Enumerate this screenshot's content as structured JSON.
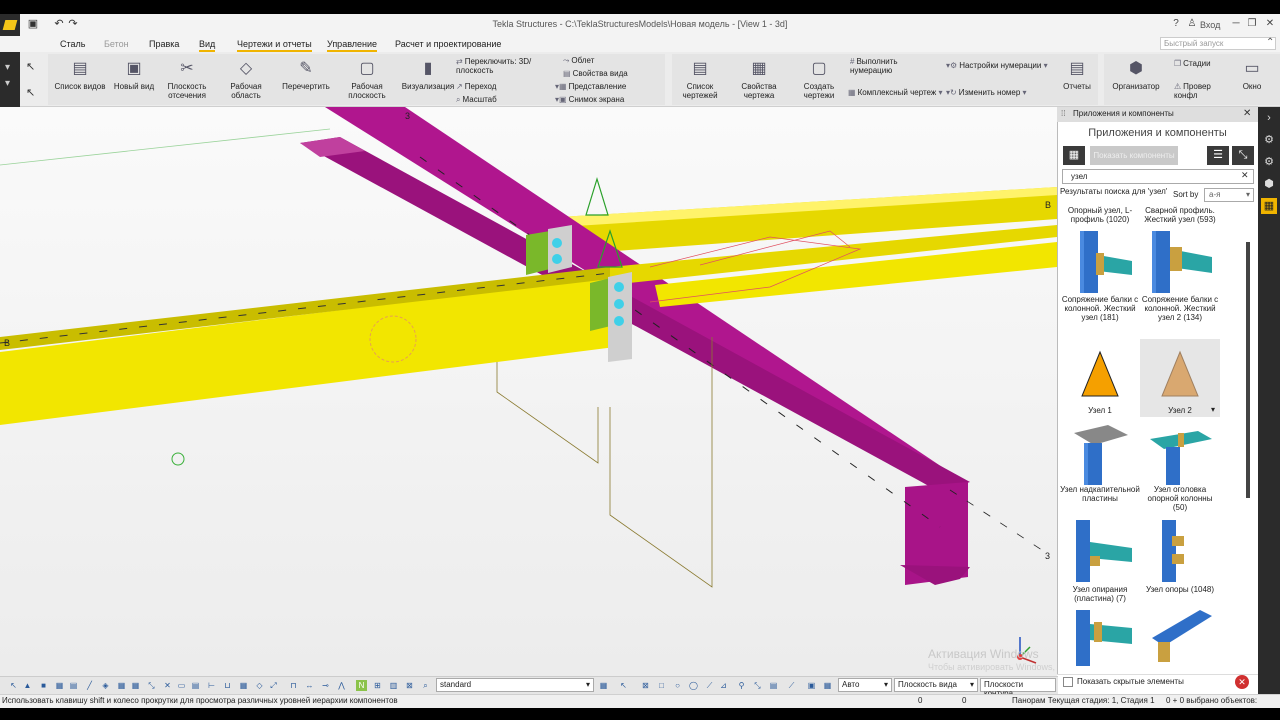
{
  "title": "Tekla Structures - C:\\TeklaStructuresModels\\Новая модель  - [View 1 - 3d]",
  "window_controls": {
    "help": "?",
    "user": "Вход"
  },
  "menu": [
    "Сталь",
    "Бетон",
    "Правка",
    "Вид",
    "Чертежи и отчеты",
    "Управление",
    "Расчет и проектирование"
  ],
  "quick_launch_placeholder": "Быстрый запуск",
  "ribbon": {
    "list_views": "Список видов",
    "new_view": "Новый вид",
    "clip_plane": "Плоскость отсечения",
    "work_area": "Рабочая область",
    "redraw": "Перечертить",
    "work_plane": "Рабочая плоскость",
    "visualization": "Визуализация",
    "switch_3d": "Переключить: 3D/ плоскость",
    "transition": "Переход",
    "scale": "Масштаб",
    "flyby": "Облет",
    "view_props": "Свойства вида",
    "representation": "Представление",
    "screenshot": "Снимок экрана",
    "drawing_list": "Список чертежей",
    "drawing_props": "Свойства чертежа",
    "create_drawings": "Создать чертежи",
    "run_numbering": "Выполнить нумерацию",
    "numbering_settings": "Настройки нумерации",
    "assembly_drawing": "Комплексный чертеж",
    "change_number": "Изменить номер",
    "reports": "Отчеты",
    "organizer": "Организатор",
    "stages": "Стадии",
    "check_conflicts": "Провер конфл",
    "window": "Окно"
  },
  "viewport": {
    "grid_labels": [
      "3",
      "B",
      "B",
      "3"
    ],
    "watermark_title": "Активация Windows",
    "watermark_sub": "Чтобы активировать Windows, перейдите в раздел \"Параметры\"."
  },
  "panel": {
    "header": "Приложения и компоненты",
    "title": "Приложения и компоненты",
    "tab_button": "Показать компоненты",
    "search_value": "узел",
    "results_label": "Результаты поиска для 'узел'",
    "sort_label": "Sort by",
    "sort_value": "a-я",
    "items": [
      {
        "label": "Опорный узел, L-профиль (1020)",
        "icon": "no-thumb"
      },
      {
        "label": "Сварной профиль. Жесткий узел (593)",
        "icon": "no-thumb"
      },
      {
        "label": "Сопряжение балки с колонной. Жесткий узел (181)",
        "icon": "beam-column-icon"
      },
      {
        "label": "Сопряжение балки с колонной. Жесткий узел 2 (134)",
        "icon": "beam-column-icon"
      },
      {
        "label": "Узел 1",
        "icon": "triangle-orange-icon"
      },
      {
        "label": "Узел 2",
        "icon": "triangle-tan-icon"
      },
      {
        "label": "Узел надкапительной пластины",
        "icon": "cap-plate-icon"
      },
      {
        "label": "Узел оголовка опорной колонны (50)",
        "icon": "column-head-icon"
      },
      {
        "label": "Узел опирания (пластина) (7)",
        "icon": "bearing-plate-icon"
      },
      {
        "label": "Узел опоры (1048)",
        "icon": "support-icon"
      }
    ],
    "show_hidden": "Показать скрытые элементы"
  },
  "bottom": {
    "filter_value": "standard",
    "auto": "Авто",
    "view_planes": "Плоскость вида",
    "contour_planes": "Плоскости контура"
  },
  "status": {
    "hint": "Использовать клавишу shift и колесо прокрутки для просмотра различных уровней иерархии компонентов",
    "zero1": "0",
    "zero2": "0",
    "stage": "Панорам Текущая стадия: 1, Стадия 1",
    "selected": "0 + 0 выбрано объектов:"
  },
  "colors": {
    "beam_yellow": "#f2e600",
    "beam_magenta": "#b0168e",
    "plate_green": "#7ab82a",
    "accent": "#f0b400"
  }
}
